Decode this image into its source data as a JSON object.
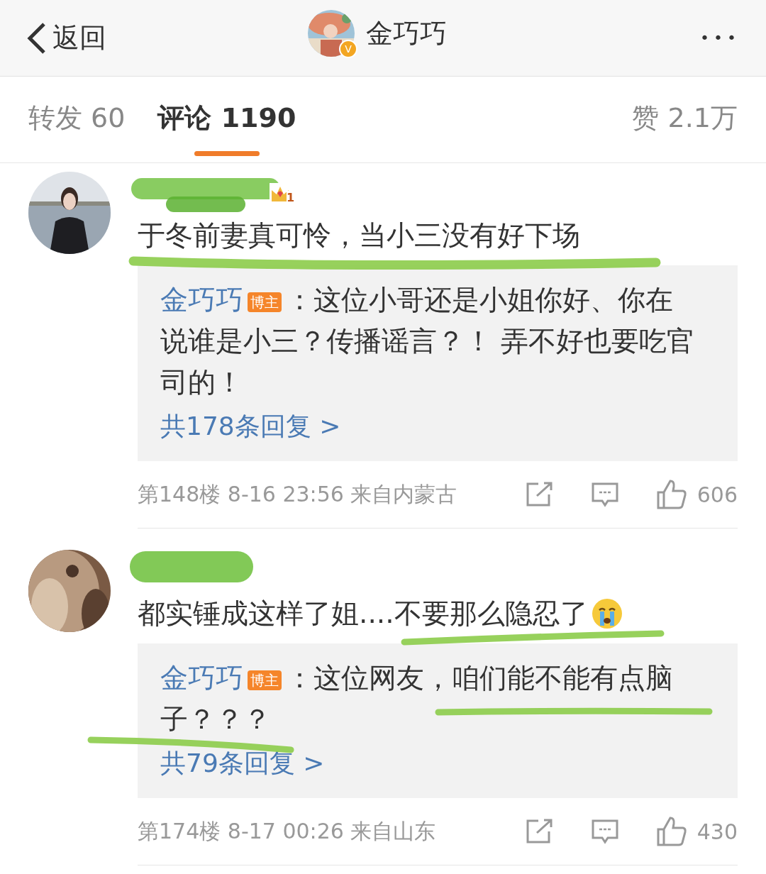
{
  "header": {
    "back": "返回",
    "title": "金巧巧",
    "verified_badge": "V",
    "more": "•••"
  },
  "tabs": [
    {
      "label": "转发 60",
      "selected": false
    },
    {
      "label": "评论 1190",
      "selected": true
    }
  ],
  "likes_tab": "赞 2.1万",
  "comments": [
    {
      "rank_badge": "1",
      "text": "于冬前妻真可怜，当小三没有好下场",
      "reply": {
        "author": "金巧巧",
        "badge": "博主",
        "text": "：这位小哥还是小姐你好、你在说谁是小三？传播谣言？！ 弄不好也要吃官司的！"
      },
      "reply_count": "共178条回复 >",
      "meta": "第148楼 8-16 23:56 来自内蒙古",
      "likes": "606",
      "emoji": false
    },
    {
      "text": "都实锤成这样了姐....不要那么隐忍了",
      "reply": {
        "author": "金巧巧",
        "badge": "博主",
        "text": "：这位网友，咱们能不能有点脑子？？？"
      },
      "reply_count": "共79条回复 >",
      "meta": "第174楼 8-17 00:26 来自山东",
      "likes": "430",
      "emoji": true
    }
  ]
}
